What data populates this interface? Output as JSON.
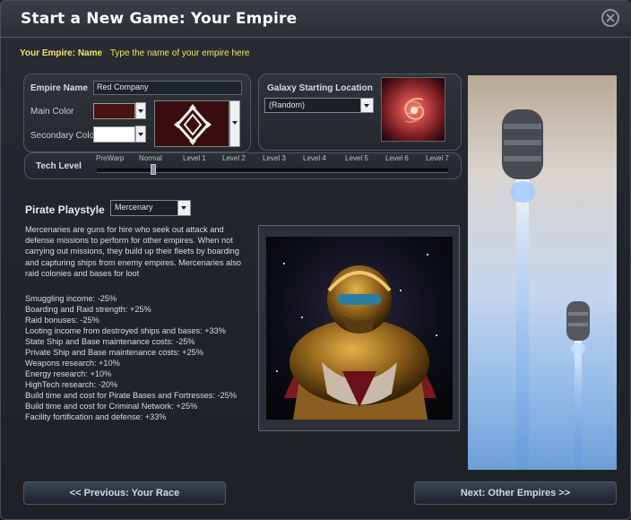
{
  "window": {
    "title": "Start a New Game: Your Empire"
  },
  "empire_name_row": {
    "label": "Your Empire: Name",
    "hint": "Type the name of your empire here"
  },
  "empire_panel": {
    "name_label": "Empire Name",
    "name_value": "Red Company",
    "main_color_label": "Main Color",
    "secondary_color_label": "Secondary Color",
    "main_color": "#4a1416",
    "secondary_color": "#ffffff"
  },
  "galaxy": {
    "label": "Galaxy Starting Location",
    "selected": "(Random)"
  },
  "tech": {
    "label": "Tech Level",
    "levels": [
      "PreWarp",
      "Normal",
      "Level 1",
      "Level 2",
      "Level 3",
      "Level 4",
      "Level 5",
      "Level 6",
      "Level 7"
    ],
    "selected": "Normal"
  },
  "playstyle": {
    "label": "Pirate Playstyle",
    "selected": "Mercenary",
    "description": "Mercenaries are guns for hire who seek out attack and defense missions to perform for other empires. When not carrying out missions, they build up their fleets by boarding and capturing ships from enemy empires. Mercenaries also raid colonies and bases for loot",
    "bonuses": [
      "Smuggling income: -25%",
      "Boarding and Raid strength: +25%",
      "Raid bonuses: -25%",
      "Looting income from destroyed ships and bases: +33%",
      "State Ship and Base maintenance costs: -25%",
      "Private Ship and Base maintenance costs: +25%",
      "Weapons research: +10%",
      "Energy research: +10%",
      "HighTech research: -20%",
      "Build time and cost for Pirate Bases and Fortresses: -25%",
      "Build time and cost for Criminal Network: +25%",
      "Facility fortification and defense: +33%"
    ]
  },
  "nav": {
    "previous": "<< Previous: Your Race",
    "next": "Next: Other Empires >>"
  },
  "colors": {
    "accent_yellow": "#f0e36a",
    "panel_border": "#505760"
  }
}
